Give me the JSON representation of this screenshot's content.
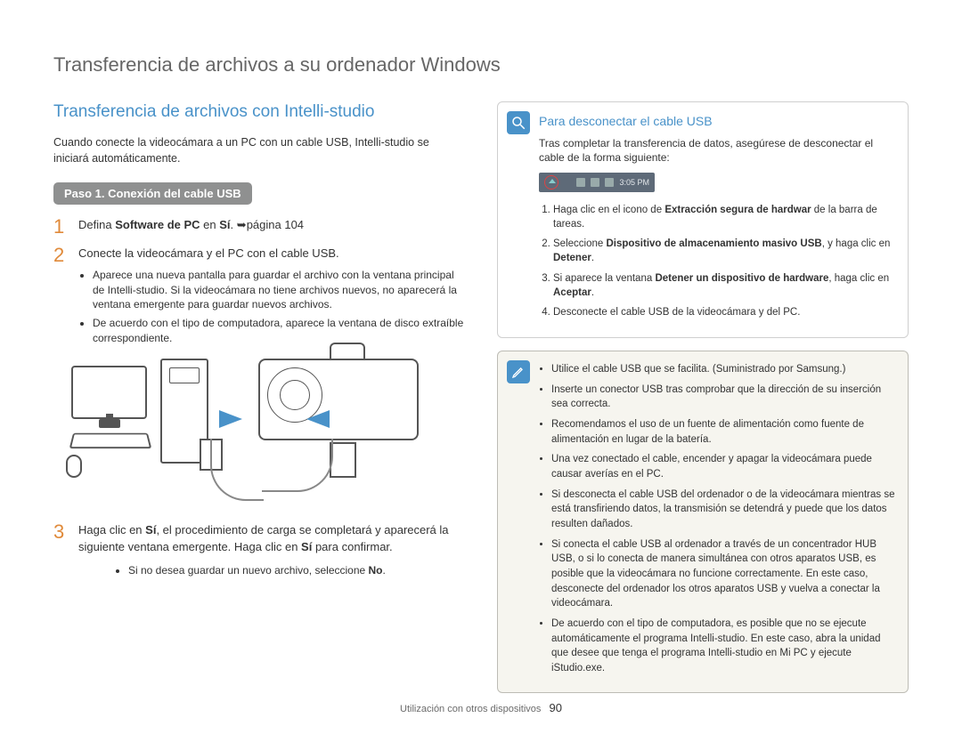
{
  "page_title": "Transferencia de archivos a su ordenador Windows",
  "section_title": "Transferencia de archivos con Intelli-studio",
  "intro": "Cuando conecte la videocámara a un PC con un cable USB, Intelli-studio se iniciará automáticamente.",
  "step_pill": "Paso 1. Conexión del cable USB",
  "step1": {
    "num": "1",
    "text_before": "Defina ",
    "bold1": "Software de PC",
    "mid": " en ",
    "bold2": "Sí",
    "after": ". ",
    "arrow": "➥",
    "ref": "página 104"
  },
  "step2": {
    "num": "2",
    "text": "Conecte la videocámara y el PC con el cable USB.",
    "bullets": [
      "Aparece una nueva pantalla para guardar el archivo con la ventana principal de Intelli-studio. Si la videocámara no tiene archivos nuevos, no aparecerá la ventana emergente para guardar nuevos archivos.",
      "De acuerdo con el tipo de computadora, aparece la ventana de disco extraíble correspondiente."
    ]
  },
  "step3": {
    "num": "3",
    "t1": "Haga clic en ",
    "b1": "Sí",
    "t2": ", el procedimiento de carga se completará y aparecerá la siguiente ventana emergente. Haga clic en ",
    "b2": "Sí",
    "t3": " para confirmar.",
    "sub_bullet_pre": "Si no desea guardar un nuevo archivo, seleccione ",
    "sub_bullet_bold": "No",
    "sub_bullet_post": "."
  },
  "disconnect": {
    "title": "Para desconectar el cable USB",
    "intro": "Tras completar la transferencia de datos, asegúrese de desconectar el cable de la forma siguiente:",
    "taskbar_time": "3:05 PM",
    "items": [
      {
        "pre": "Haga clic en el icono de ",
        "bold": "Extracción segura de hardwar",
        "post": " de la barra de tareas."
      },
      {
        "pre": "Seleccione ",
        "bold": "Dispositivo de almacenamiento masivo USB",
        "post": ", y haga clic en ",
        "bold2": "Detener",
        "post2": "."
      },
      {
        "pre": "Si aparece la ventana ",
        "bold": "Detener un dispositivo de hardware",
        "post": ", haga clic en ",
        "bold2": "Aceptar",
        "post2": "."
      },
      {
        "pre": "Desconecte el cable USB de la videocámara y del PC.",
        "bold": "",
        "post": ""
      }
    ]
  },
  "notes": [
    "Utilice el cable USB que se facilita. (Suministrado por Samsung.)",
    "Inserte un conector USB tras comprobar que la dirección de su inserción sea correcta.",
    "Recomendamos el uso de un fuente de alimentación como fuente de alimentación en lugar de la batería.",
    "Una vez conectado el cable, encender y apagar la videocámara puede causar averías en el PC.",
    "Si desconecta el cable USB del ordenador o de la videocámara mientras se está transfiriendo datos, la transmisión se detendrá y puede que los datos resulten dañados.",
    "Si conecta el cable USB al ordenador a través de un concentrador HUB USB, o si lo conecta de manera simultánea con otros aparatos USB, es posible que la videocámara no funcione correctamente. En este caso, desconecte del ordenador los otros aparatos USB y vuelva a conectar la videocámara.",
    "De acuerdo con el tipo de computadora, es posible que no se ejecute automáticamente el programa Intelli-studio. En este caso, abra la unidad que desee que tenga el programa Intelli-studio en Mi PC y ejecute iStudio.exe."
  ],
  "footer_text": "Utilización con otros dispositivos",
  "page_number": "90"
}
